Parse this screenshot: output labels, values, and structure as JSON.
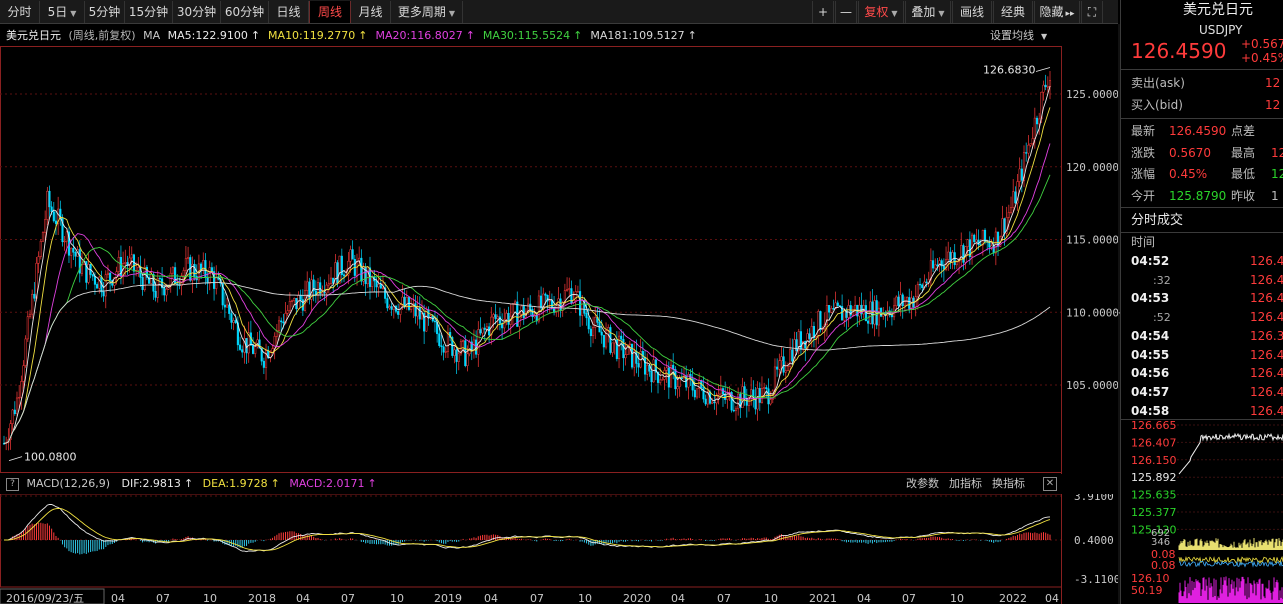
{
  "toolbar": {
    "tabs": [
      {
        "label": "分时",
        "caret": false,
        "active": false
      },
      {
        "label": "5日",
        "caret": true,
        "active": false
      },
      {
        "label": "5分钟",
        "caret": false,
        "active": false
      },
      {
        "label": "15分钟",
        "caret": false,
        "active": false
      },
      {
        "label": "30分钟",
        "caret": false,
        "active": false
      },
      {
        "label": "60分钟",
        "caret": false,
        "active": false
      },
      {
        "label": "日线",
        "caret": false,
        "active": false
      },
      {
        "label": "周线",
        "caret": false,
        "active": true
      },
      {
        "label": "月线",
        "caret": false,
        "active": false
      },
      {
        "label": "更多周期",
        "caret": true,
        "active": false
      }
    ],
    "right_tools": [
      {
        "label": "+",
        "name": "zoom-in-button"
      },
      {
        "label": "—",
        "name": "zoom-out-button"
      },
      {
        "label": "复权",
        "name": "adjust-button",
        "caret": true,
        "red": true
      },
      {
        "label": "叠加",
        "name": "overlay-button",
        "caret": true
      },
      {
        "label": "画线",
        "name": "draw-line-button"
      },
      {
        "label": "经典",
        "name": "classic-button"
      },
      {
        "label": "隐藏",
        "name": "hide-button",
        "suffix": "▸▸"
      },
      {
        "label": "⛶",
        "name": "fullscreen-icon"
      }
    ]
  },
  "ma_bar": {
    "title": "美元兑日元",
    "subtitle": "(周线,前复权)",
    "ma_label": "MA",
    "ma_items": [
      {
        "text": "MA5:122.9100",
        "arrow": "↑",
        "color": "#e8e8e8"
      },
      {
        "text": "MA10:119.2770",
        "arrow": "↑",
        "color": "#f0e040"
      },
      {
        "text": "MA20:116.8027",
        "arrow": "↑",
        "color": "#e040e0"
      },
      {
        "text": "MA30:115.5524",
        "arrow": "↑",
        "color": "#40d040"
      },
      {
        "text": "MA181:109.5127",
        "arrow": "↑",
        "color": "#d8d8d8"
      }
    ],
    "settings_label": "设置均线"
  },
  "chart_data": {
    "type": "candlestick",
    "title": "美元兑日元",
    "subtitle": "(周线,前复权)",
    "y_ticks": [
      "125.0000",
      "120.0000",
      "115.0000",
      "110.0000",
      "105.0000"
    ],
    "ylim": [
      99.5,
      127.5
    ],
    "x_labels": [
      "2016/09/23/五",
      "04",
      "07",
      "10",
      "2018",
      "04",
      "07",
      "10",
      "2019",
      "04",
      "07",
      "10",
      "2020",
      "04",
      "07",
      "10",
      "2021",
      "04",
      "07",
      "10",
      "2022",
      "04"
    ],
    "high_annotation": "126.6830",
    "low_annotation": "100.0800",
    "up_color": "#ff3b3b",
    "down_color": "#00d8ff",
    "macd": {
      "params": "MACD(12,26,9)",
      "dif": "DIF:2.9813",
      "dea": "DEA:1.9728",
      "macd_val": "MACD:2.0171",
      "y_ticks": [
        "3.9100",
        "0.4000",
        "-3.1100"
      ],
      "actions": [
        "改参数",
        "加指标",
        "换指标"
      ]
    }
  },
  "quote": {
    "name": "美元兑日元",
    "code": "USDJPY",
    "price": "126.4590",
    "change": "+0.567",
    "change_pct": "+0.45%",
    "rows": [
      {
        "label": "卖出(ask)",
        "value": "12",
        "color": "red"
      },
      {
        "label": "买入(bid)",
        "value": "12",
        "color": "red"
      }
    ],
    "stats": [
      {
        "l1": "最新",
        "v1": "126.4590",
        "c1": "red",
        "l2": "点差",
        "v2": "",
        "c2": "red"
      },
      {
        "l1": "涨跌",
        "v1": "0.5670",
        "c1": "red",
        "l2": "最高",
        "v2": "12",
        "c2": "red"
      },
      {
        "l1": "涨幅",
        "v1": "0.45%",
        "c1": "red",
        "l2": "最低",
        "v2": "12",
        "c2": "green"
      },
      {
        "l1": "今开",
        "v1": "125.8790",
        "c1": "green",
        "l2": "昨收",
        "v2": "1",
        "c2": "gray"
      }
    ],
    "trades_header": "分时成交",
    "time_col": "时间",
    "trades": [
      {
        "t": "04:52",
        "p": "126.4",
        "bold": true
      },
      {
        "t": ":32",
        "p": "126.4",
        "bold": false
      },
      {
        "t": "04:53",
        "p": "126.4",
        "bold": true
      },
      {
        "t": ":52",
        "p": "126.4",
        "bold": false
      },
      {
        "t": "04:54",
        "p": "126.3",
        "bold": true
      },
      {
        "t": "04:55",
        "p": "126.4",
        "bold": true
      },
      {
        "t": "04:56",
        "p": "126.4",
        "bold": true
      },
      {
        "t": "04:57",
        "p": "126.4",
        "bold": true
      },
      {
        "t": "04:58",
        "p": "126.4",
        "bold": true
      }
    ],
    "mini_chart": {
      "y_ticks": [
        {
          "v": "126.665",
          "c": "red"
        },
        {
          "v": "126.407",
          "c": "red"
        },
        {
          "v": "126.150",
          "c": "red"
        },
        {
          "v": "125.892",
          "c": "white"
        },
        {
          "v": "125.635",
          "c": "green"
        },
        {
          "v": "125.377",
          "c": "green"
        },
        {
          "v": "125.120",
          "c": "green"
        }
      ],
      "vol_ticks": [
        "692",
        "346"
      ],
      "ind_ticks": [
        {
          "v": "0.08",
          "c": "red"
        },
        {
          "v": "0.08",
          "c": "red"
        }
      ],
      "bottom_ticks": [
        {
          "v": "126.10",
          "c": "red"
        },
        {
          "v": "50.19",
          "c": "red"
        }
      ]
    }
  }
}
